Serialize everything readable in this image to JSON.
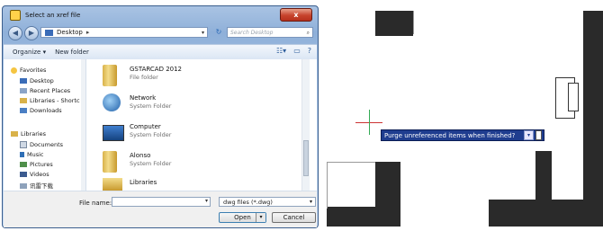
{
  "dialog": {
    "title": "Select an xref file",
    "close_glyph": "x",
    "address": {
      "segment": "Desktop",
      "chevron": "▸"
    },
    "search_placeholder": "Search Desktop",
    "toolbar": {
      "organize": "Organize ▾",
      "new_folder": "New folder"
    },
    "nav": {
      "favorites_header": "Favorites",
      "favorites": [
        "Desktop",
        "Recent Places",
        "Libraries - Shortc",
        "Downloads"
      ],
      "libraries_header": "Libraries",
      "libraries": [
        "Documents",
        "Music",
        "Pictures",
        "Videos",
        "讯雷下载"
      ]
    },
    "files": [
      {
        "name": "GSTARCAD 2012",
        "type": "File folder"
      },
      {
        "name": "Network",
        "type": "System Folder"
      },
      {
        "name": "Computer",
        "type": "System Folder"
      },
      {
        "name": "Alonso",
        "type": "System Folder"
      },
      {
        "name": "Libraries",
        "type": ""
      }
    ],
    "file_name_label": "File name:",
    "file_name_value": "",
    "file_type_value": "dwg files (*.dwg)",
    "open_label": "Open",
    "cancel_label": "Cancel"
  },
  "cad": {
    "prompt_text": "Purge unreferenced items when finished?"
  },
  "colors": {
    "prompt_bg": "#1f3d8f",
    "wall": "#2a2a2a",
    "close": "#c7432c"
  }
}
